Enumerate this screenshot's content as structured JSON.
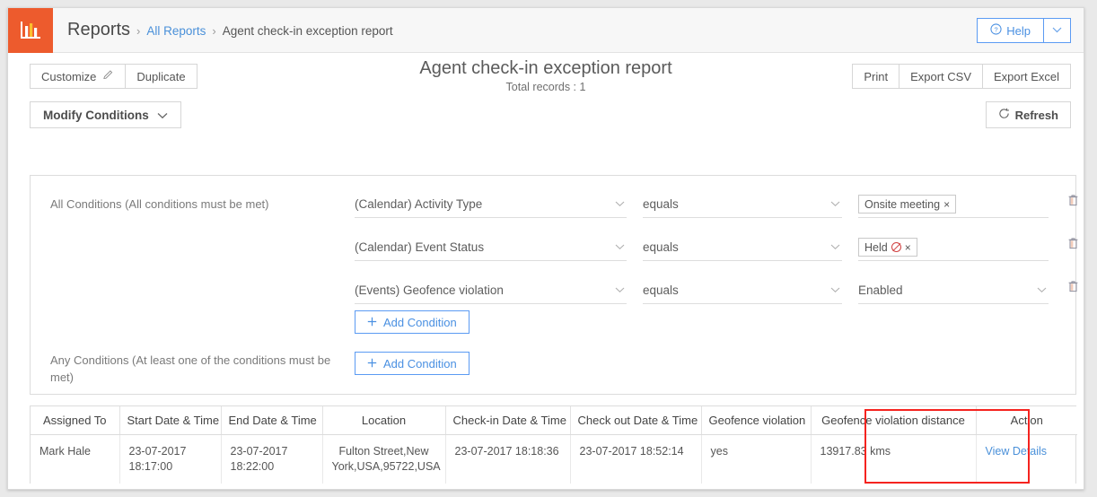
{
  "header": {
    "logo_icon": "bar-chart-icon",
    "breadcrumb": {
      "root": "Reports",
      "separator": "›",
      "link": "All Reports",
      "current": "Agent check-in exception report"
    },
    "help_label": "Help",
    "help_icon": "question-circle-icon",
    "help_caret_icon": "chevron-down-icon"
  },
  "toolbar": {
    "customize_label": "Customize",
    "customize_icon": "pencil-icon",
    "duplicate_label": "Duplicate",
    "print_label": "Print",
    "export_csv_label": "Export CSV",
    "export_excel_label": "Export Excel",
    "title": "Agent check-in exception report",
    "total_records": "Total records : 1",
    "modify_conditions_label": "Modify Conditions",
    "modify_conditions_icon": "chevron-down-icon",
    "refresh_label": "Refresh",
    "refresh_icon": "refresh-icon"
  },
  "conditions": {
    "all_label": "All Conditions (All conditions must be met)",
    "any_label": "Any Conditions (At least one of the conditions must be met)",
    "add_condition_label": "Add Condition",
    "add_condition_icon": "plus-icon",
    "delete_icon": "trash-icon",
    "rows": [
      {
        "field": "(Calendar) Activity Type",
        "operator": "equals",
        "value_type": "tag",
        "value": "Onsite meeting",
        "value_icon": "",
        "remove_icon": "×"
      },
      {
        "field": "(Calendar) Event Status",
        "operator": "equals",
        "value_type": "tag",
        "value": "Held",
        "value_icon": "no-entry-icon",
        "remove_icon": "×"
      },
      {
        "field": "(Events) Geofence violation",
        "operator": "equals",
        "value_type": "select",
        "value": "Enabled",
        "value_icon": "",
        "remove_icon": ""
      }
    ]
  },
  "results_table": {
    "columns": [
      "Assigned To",
      "Start Date & Time",
      "End Date & Time",
      "Location",
      "Check-in Date & Time",
      "Check out Date & Time",
      "Geofence violation",
      "Geofence violation distance",
      "Action"
    ],
    "rows": [
      {
        "assigned_to": "Mark Hale",
        "start_date_time": "23-07-2017 18:17:00",
        "end_date_time": "23-07-2017 18:22:00",
        "location": "Fulton Street,New York,USA,95722,USA",
        "checkin_date_time": "23-07-2017 18:18:36",
        "checkout_date_time": "23-07-2017 18:52:14",
        "geofence_violation": "yes",
        "geofence_violation_distance": "13917.83 kms",
        "action": "View Details"
      }
    ],
    "highlight_color": "#f5231f",
    "highlighted_column": "Geofence violation distance"
  },
  "colors": {
    "brand": "#ed5b2d",
    "link": "#4a90d9",
    "accent_blue": "#5b9bf3",
    "annotation_red": "#f5231f"
  }
}
